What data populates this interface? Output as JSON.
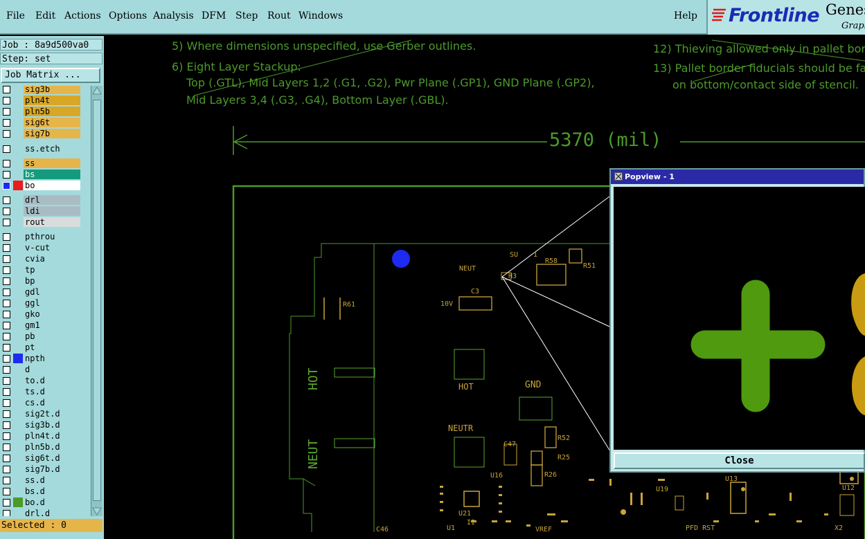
{
  "menu": {
    "items": [
      "File",
      "Edit",
      "Actions",
      "Options",
      "Analysis",
      "DFM",
      "Step",
      "Rout",
      "Windows"
    ],
    "help": "Help"
  },
  "logo": {
    "brand": "Frontline",
    "product": "Genes",
    "subtitle": "Graph"
  },
  "job": {
    "job_line": "Job : 8a9d500va0",
    "step_line": "Step: set",
    "matrix_button": "Job Matrix ..."
  },
  "layers": [
    {
      "name": "sig3b",
      "bg": "#e6b54a",
      "color": ""
    },
    {
      "name": "pln4t",
      "bg": "#d9a626",
      "color": ""
    },
    {
      "name": "pln5b",
      "bg": "#d9a626",
      "color": ""
    },
    {
      "name": "sig6t",
      "bg": "#e6b54a",
      "color": ""
    },
    {
      "name": "sig7b",
      "bg": "#e6b54a",
      "color": ""
    },
    {
      "name": "ss.etch",
      "bg": "#a4dadc",
      "color": ""
    },
    {
      "name": "ss",
      "bg": "#e6b54a",
      "color": ""
    },
    {
      "name": "bs",
      "bg": "#159a7d",
      "color": ""
    },
    {
      "name": "bo",
      "bg": "#ffffff",
      "color": "#e81d1d"
    },
    {
      "name": "drl",
      "bg": "#a9bcc4",
      "color": ""
    },
    {
      "name": "ldi",
      "bg": "#a9bcc4",
      "color": ""
    },
    {
      "name": "rout",
      "bg": "#d8dcdc",
      "color": ""
    },
    {
      "name": "pthrou",
      "bg": "#a4dadc",
      "color": ""
    },
    {
      "name": "v-cut",
      "bg": "#a4dadc",
      "color": ""
    },
    {
      "name": "cvia",
      "bg": "#a4dadc",
      "color": ""
    },
    {
      "name": "tp",
      "bg": "#a4dadc",
      "color": ""
    },
    {
      "name": "bp",
      "bg": "#a4dadc",
      "color": ""
    },
    {
      "name": "gdl",
      "bg": "#a4dadc",
      "color": ""
    },
    {
      "name": "ggl",
      "bg": "#a4dadc",
      "color": ""
    },
    {
      "name": "gko",
      "bg": "#a4dadc",
      "color": ""
    },
    {
      "name": "gm1",
      "bg": "#a4dadc",
      "color": ""
    },
    {
      "name": "pb",
      "bg": "#a4dadc",
      "color": ""
    },
    {
      "name": "pt",
      "bg": "#a4dadc",
      "color": ""
    },
    {
      "name": "npth",
      "bg": "#a4dadc",
      "color": "#1d2bf0"
    },
    {
      "name": "d",
      "bg": "#a4dadc",
      "color": ""
    },
    {
      "name": "to.d",
      "bg": "#a4dadc",
      "color": ""
    },
    {
      "name": "ts.d",
      "bg": "#a4dadc",
      "color": ""
    },
    {
      "name": "cs.d",
      "bg": "#a4dadc",
      "color": ""
    },
    {
      "name": "sig2t.d",
      "bg": "#a4dadc",
      "color": ""
    },
    {
      "name": "sig3b.d",
      "bg": "#a4dadc",
      "color": ""
    },
    {
      "name": "pln4t.d",
      "bg": "#a4dadc",
      "color": ""
    },
    {
      "name": "pln5b.d",
      "bg": "#a4dadc",
      "color": ""
    },
    {
      "name": "sig6t.d",
      "bg": "#a4dadc",
      "color": ""
    },
    {
      "name": "sig7b.d",
      "bg": "#a4dadc",
      "color": ""
    },
    {
      "name": "ss.d",
      "bg": "#a4dadc",
      "color": ""
    },
    {
      "name": "bs.d",
      "bg": "#a4dadc",
      "color": ""
    },
    {
      "name": "bo.d",
      "bg": "#a4dadc",
      "color": "#4c9a2a"
    },
    {
      "name": "drl.d",
      "bg": "#a4dadc",
      "color": ""
    }
  ],
  "selected": "Selected : 0",
  "notes": {
    "n5": "5) Where dimensions unspecified, use Gerber outlines.",
    "n6": "6) Eight Layer Stackup:",
    "n6a": "Top (.GTL), Mid Layers 1,2 (.G1, .G2), Pwr Plane (.GP1), GND Plane (.GP2),",
    "n6b": "Mid Layers 3,4 (.G3, .G4), Bottom Layer (.GBL).",
    "n12": "12) Thieving allowed only in pallet bor",
    "n13": "13) Pallet border fiducials should be fa",
    "n13b": "on bottom/contact side of stencil."
  },
  "dimension": "5370 (mil)",
  "silk": {
    "hot_big": "HOT",
    "neut_big": "NEUT",
    "hot": "HOT",
    "neutr": "NEUTR",
    "gnd": "GND",
    "neut": "NEUT",
    "r61": "R61",
    "c3": "C3",
    "r58": "R58",
    "r51": "R51",
    "r52": "R52",
    "r25": "R25",
    "r26": "R26",
    "c47": "C47",
    "u16": "U16",
    "u13": "U13",
    "u21": "U21",
    "u19": "U19",
    "u12": "U12",
    "x2": "X2",
    "c46": "C46",
    "vref": "VREF",
    "pfd_rst": "PFD RST",
    "ten_v": "10V",
    "h3": "H3",
    "su": "SU",
    "one": "1",
    "u1": "U1",
    "ii": "II"
  },
  "popview": {
    "title": "Popview - 1",
    "close": "Close"
  },
  "colors": {
    "accent_green": "#4c9a2a",
    "plus_green": "#4f9a0e",
    "gold": "#c9a53a",
    "blue_dot": "#1d2bf0"
  }
}
